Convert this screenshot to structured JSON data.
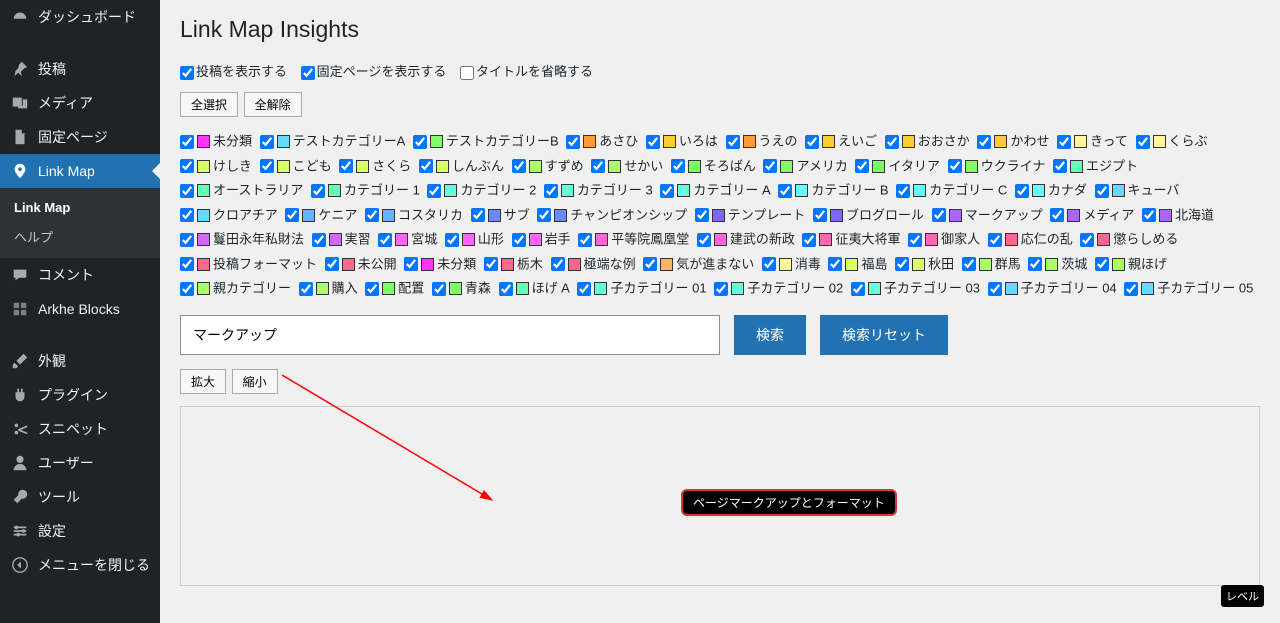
{
  "sidebar": {
    "items": [
      {
        "id": "dashboard",
        "label": "ダッシュボード"
      },
      {
        "id": "posts",
        "label": "投稿"
      },
      {
        "id": "media",
        "label": "メディア"
      },
      {
        "id": "pages",
        "label": "固定ページ"
      },
      {
        "id": "linkmap",
        "label": "Link Map"
      },
      {
        "id": "comments",
        "label": "コメント"
      },
      {
        "id": "arkhe",
        "label": "Arkhe Blocks"
      },
      {
        "id": "appearance",
        "label": "外観"
      },
      {
        "id": "plugins",
        "label": "プラグイン"
      },
      {
        "id": "snippets",
        "label": "スニペット"
      },
      {
        "id": "users",
        "label": "ユーザー"
      },
      {
        "id": "tools",
        "label": "ツール"
      },
      {
        "id": "settings",
        "label": "設定"
      },
      {
        "id": "collapse",
        "label": "メニューを閉じる"
      }
    ],
    "sub": {
      "items": [
        {
          "label": "Link Map",
          "cur": true
        },
        {
          "label": "ヘルプ"
        }
      ]
    }
  },
  "page": {
    "title": "Link Map Insights",
    "filter": {
      "show_posts": {
        "label": "投稿を表示する",
        "checked": true
      },
      "show_pages": {
        "label": "固定ページを表示する",
        "checked": true
      },
      "abbrev": {
        "label": "タイトルを省略する",
        "checked": false
      }
    },
    "select_all": "全選択",
    "deselect_all": "全解除",
    "search": {
      "value": "マークアップ",
      "button": "検索",
      "reset": "検索リセット"
    },
    "zoom": {
      "in": "拡大",
      "out": "縮小"
    },
    "node_label": "ページマークアップとフォーマット",
    "level_label": "レベル"
  },
  "categories": [
    {
      "label": "未分類",
      "color": "#ff33ff"
    },
    {
      "label": "テストカテゴリーA",
      "color": "#66d9ff"
    },
    {
      "label": "テストカテゴリーB",
      "color": "#7eff66"
    },
    {
      "label": "あさひ",
      "color": "#ff9933"
    },
    {
      "label": "いろは",
      "color": "#ffcc33"
    },
    {
      "label": "うえの",
      "color": "#ff9933"
    },
    {
      "label": "えいご",
      "color": "#ffcc33"
    },
    {
      "label": "おおさか",
      "color": "#ffcc33"
    },
    {
      "label": "かわせ",
      "color": "#ffcc33"
    },
    {
      "label": "きって",
      "color": "#fff799"
    },
    {
      "label": "くらぶ",
      "color": "#fff799"
    },
    {
      "label": "けしき",
      "color": "#d9ff66"
    },
    {
      "label": "こども",
      "color": "#d9ff66"
    },
    {
      "label": "さくら",
      "color": "#d9ff66"
    },
    {
      "label": "しんぶん",
      "color": "#d9ff66"
    },
    {
      "label": "すずめ",
      "color": "#aaff66"
    },
    {
      "label": "せかい",
      "color": "#aaff66"
    },
    {
      "label": "そろばん",
      "color": "#7eff66"
    },
    {
      "label": "アメリカ",
      "color": "#7eff66"
    },
    {
      "label": "イタリア",
      "color": "#7eff66"
    },
    {
      "label": "ウクライナ",
      "color": "#7eff66"
    },
    {
      "label": "エジプト",
      "color": "#66ffb3"
    },
    {
      "label": "オーストラリア",
      "color": "#66ffb3"
    },
    {
      "label": "カテゴリー 1",
      "color": "#66ffb3"
    },
    {
      "label": "カテゴリー 2",
      "color": "#66ffd9"
    },
    {
      "label": "カテゴリー 3",
      "color": "#66ffd9"
    },
    {
      "label": "カテゴリー A",
      "color": "#66ffd9"
    },
    {
      "label": "カテゴリー B",
      "color": "#66ffff"
    },
    {
      "label": "カテゴリー C",
      "color": "#66ffff"
    },
    {
      "label": "カナダ",
      "color": "#66ffff"
    },
    {
      "label": "キューバ",
      "color": "#66d9ff"
    },
    {
      "label": "クロアチア",
      "color": "#66d9ff"
    },
    {
      "label": "ケニア",
      "color": "#66b3ff"
    },
    {
      "label": "コスタリカ",
      "color": "#66b3ff"
    },
    {
      "label": "サブ",
      "color": "#668cff"
    },
    {
      "label": "チャンピオンシップ",
      "color": "#668cff"
    },
    {
      "label": "テンプレート",
      "color": "#7e66ff"
    },
    {
      "label": "ブログロール",
      "color": "#7e66ff"
    },
    {
      "label": "マークアップ",
      "color": "#aa66ff"
    },
    {
      "label": "メディア",
      "color": "#aa66ff"
    },
    {
      "label": "北海道",
      "color": "#aa66ff"
    },
    {
      "label": "鬘田永年私財法",
      "color": "#d266ff"
    },
    {
      "label": "実習",
      "color": "#d266ff"
    },
    {
      "label": "宮城",
      "color": "#ff66ff"
    },
    {
      "label": "山形",
      "color": "#ff66ff"
    },
    {
      "label": "岩手",
      "color": "#ff66ff"
    },
    {
      "label": "平等院鳳凰堂",
      "color": "#ff66d9"
    },
    {
      "label": "建武の新政",
      "color": "#ff66d9"
    },
    {
      "label": "征夷大将軍",
      "color": "#ff66b3"
    },
    {
      "label": "御家人",
      "color": "#ff66b3"
    },
    {
      "label": "応仁の乱",
      "color": "#ff668c"
    },
    {
      "label": "懲らしめる",
      "color": "#ff668c"
    },
    {
      "label": "投稿フォーマット",
      "color": "#ff668c"
    },
    {
      "label": "未公開",
      "color": "#ff668c"
    },
    {
      "label": "未分類",
      "color": "#ff33ff"
    },
    {
      "label": "栃木",
      "color": "#ff668c"
    },
    {
      "label": "極端な例",
      "color": "#ff668c"
    },
    {
      "label": "気が進まない",
      "color": "#ffb366"
    },
    {
      "label": "消毒",
      "color": "#fff799"
    },
    {
      "label": "福島",
      "color": "#d9ff66"
    },
    {
      "label": "秋田",
      "color": "#d9ff66"
    },
    {
      "label": "群馬",
      "color": "#aaff66"
    },
    {
      "label": "茨城",
      "color": "#aaff66"
    },
    {
      "label": "親ほげ",
      "color": "#aaff66"
    },
    {
      "label": "親カテゴリー",
      "color": "#aaff66"
    },
    {
      "label": "購入",
      "color": "#aaff66"
    },
    {
      "label": "配置",
      "color": "#7eff66"
    },
    {
      "label": "青森",
      "color": "#7eff66"
    },
    {
      "label": "ほげ A",
      "color": "#66ffb3"
    },
    {
      "label": "子カテゴリー 01",
      "color": "#66ffd9"
    },
    {
      "label": "子カテゴリー 02",
      "color": "#66ffd9"
    },
    {
      "label": "子カテゴリー 03",
      "color": "#66ffd9"
    },
    {
      "label": "子カテゴリー 04",
      "color": "#66d9ff"
    },
    {
      "label": "子カテゴリー 05",
      "color": "#66d9ff"
    }
  ]
}
